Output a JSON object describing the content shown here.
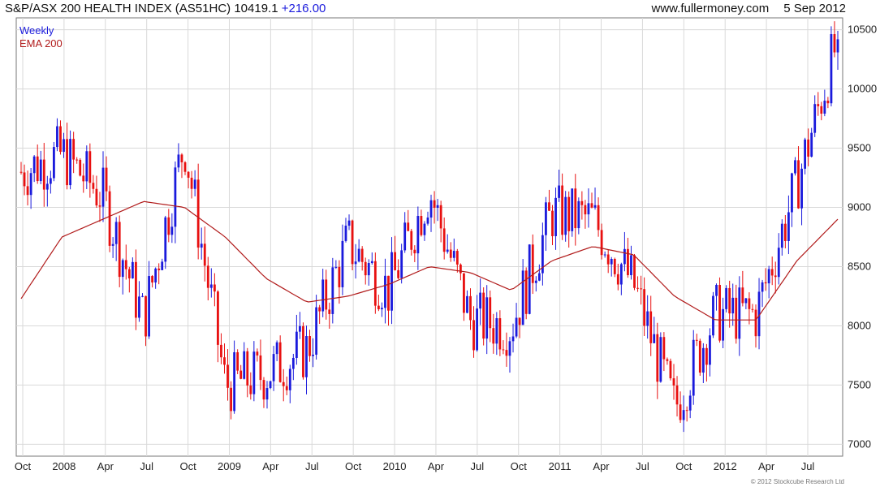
{
  "header": {
    "title": "S&P/ASX 200 HEALTH INDEX (AS51HC)",
    "last": "10419.1",
    "change": "+216.00",
    "site": "www.fullermoney.com",
    "date": "5 Sep 2012"
  },
  "legend": {
    "weekly": "Weekly",
    "ema": "EMA 200"
  },
  "footer": {
    "copyright": "© 2012 Stockcube Research Ltd"
  },
  "colors": {
    "up": "#1a1adc",
    "down": "#e81010",
    "ema": "#b11b1b",
    "grid": "#d9d9d9"
  },
  "chart_data": {
    "type": "line",
    "title": "S&P/ASX 200 HEALTH INDEX (AS51HC)",
    "xlabel": "",
    "ylabel": "",
    "x_tick_labels": [
      "Oct",
      "2008",
      "Apr",
      "Jul",
      "Oct",
      "2009",
      "Apr",
      "Jul",
      "Oct",
      "2010",
      "Apr",
      "Jul",
      "Oct",
      "2011",
      "Apr",
      "Jul",
      "Oct",
      "2012",
      "Apr",
      "Jul"
    ],
    "y_tick_labels": [
      "7000",
      "7500",
      "8000",
      "8500",
      "9000",
      "9500",
      "10000",
      "10500"
    ],
    "ylim": [
      6900,
      10600
    ],
    "grid": true,
    "legend_position": "top-left",
    "series": [
      {
        "name": "Weekly",
        "x": [
          "Oct 2007",
          "Jan 2008",
          "Apr 2008",
          "Jul 2008",
          "Oct 2008",
          "Jan 2009",
          "Apr 2009",
          "Jul 2009",
          "Oct 2009",
          "Jan 2010",
          "Apr 2010",
          "Jul 2010",
          "Oct 2010",
          "Jan 2011",
          "Apr 2011",
          "Jul 2011",
          "Oct 2011",
          "Jan 2012",
          "Apr 2012",
          "Jul 2012",
          "Sep 2012"
        ],
        "values": [
          9300,
          9450,
          9100,
          8050,
          9550,
          7500,
          7600,
          7800,
          8700,
          8300,
          9150,
          8050,
          8000,
          8950,
          8900,
          8350,
          7300,
          8100,
          8100,
          9200,
          10419
        ]
      },
      {
        "name": "EMA 200",
        "x": [
          "Oct 2007",
          "Jan 2008",
          "Apr 2008",
          "Jul 2008",
          "Oct 2008",
          "Jan 2009",
          "Apr 2009",
          "Jul 2009",
          "Oct 2009",
          "Jan 2010",
          "Apr 2010",
          "Jul 2010",
          "Oct 2010",
          "Jan 2011",
          "Apr 2011",
          "Jul 2011",
          "Oct 2011",
          "Jan 2012",
          "Apr 2012",
          "Jul 2012",
          "Sep 2012"
        ],
        "values": [
          8230,
          8750,
          8900,
          9050,
          9000,
          8750,
          8400,
          8200,
          8250,
          8350,
          8500,
          8450,
          8300,
          8550,
          8670,
          8600,
          8250,
          8050,
          8050,
          8550,
          8900
        ]
      }
    ]
  }
}
